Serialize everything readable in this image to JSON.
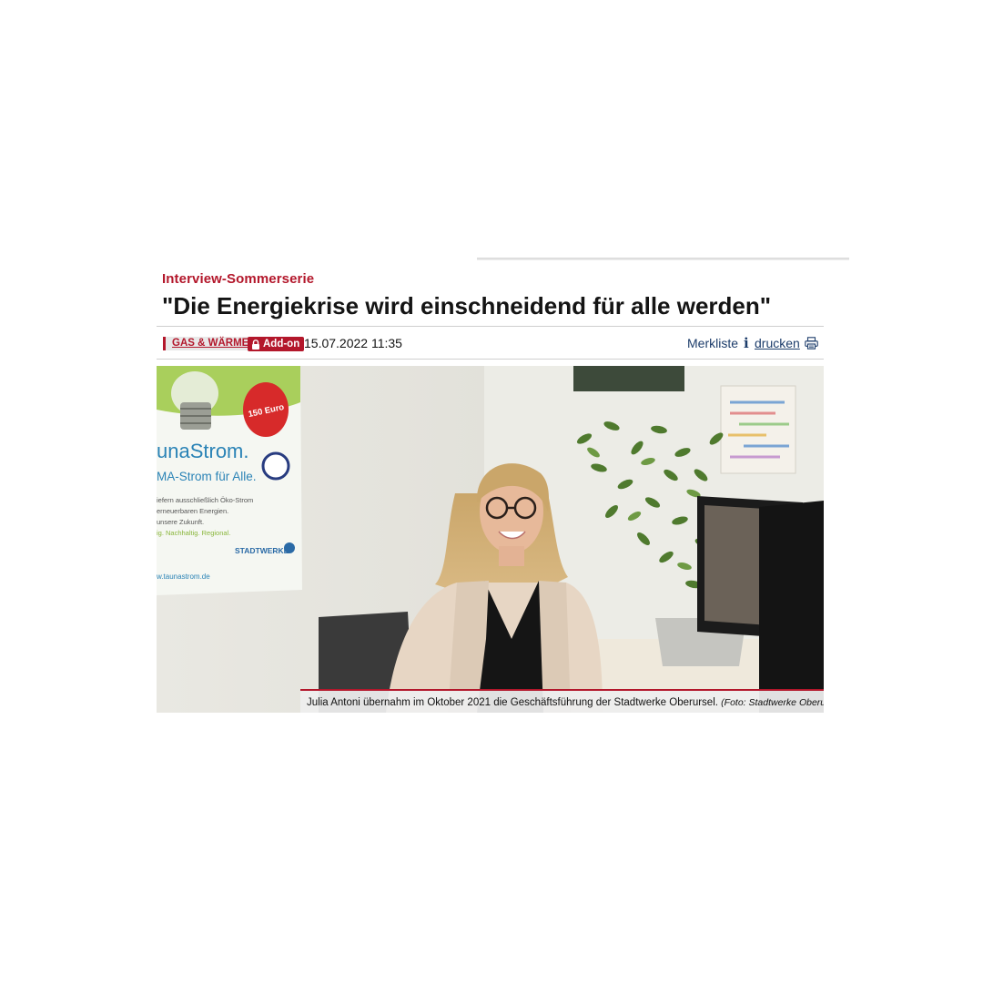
{
  "article": {
    "kicker": "Interview-Sommerserie",
    "headline": "\"Die Energiekrise wird einschneidend für alle werden\"",
    "category_tag": "GAS & WÄRME",
    "addon_badge": "Add-on",
    "date": "15.07.2022 11:35",
    "merkliste_label": "Merkliste",
    "drucken_label": "drucken",
    "photo": {
      "poster_brand": "unaStrom.",
      "poster_tagline": "MA-Strom für Alle.",
      "poster_lines": [
        "iefern ausschließlich Öko-Strom",
        "erneuerbaren Energien.",
        "unsere Zukunft.",
        "ig. Nachhaltig. Regional."
      ],
      "poster_sticker": "150 Euro",
      "poster_logo": "STADTWERKE",
      "poster_url": "w.taunastrom.de",
      "caption": "Julia Antoni übernahm im Oktober 2021 die Geschäftsführung der Stadtwerke Oberursel.",
      "credit": "(Foto: Stadtwerke Oberursel)"
    }
  },
  "colors": {
    "accent": "#b3172b",
    "link": "#1d3d6b"
  },
  "icons": {
    "lock": "lock-icon",
    "info": "info-icon",
    "print": "printer-icon"
  }
}
